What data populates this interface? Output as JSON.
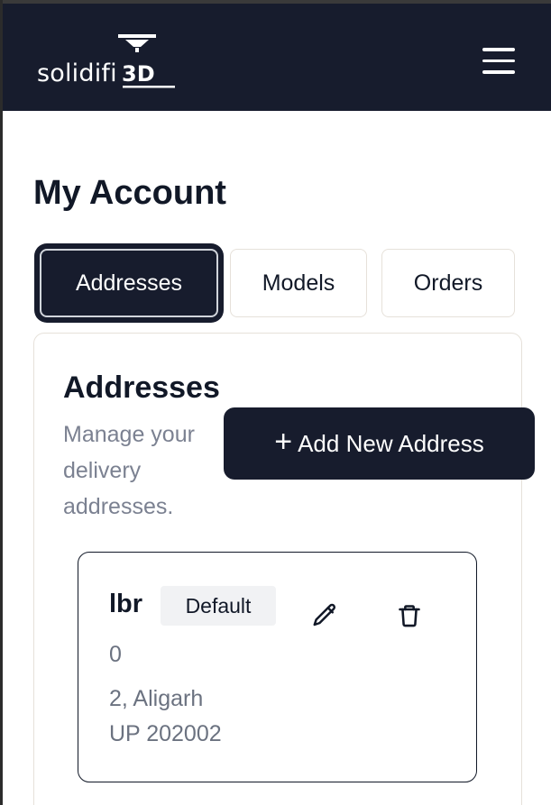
{
  "header": {
    "logo_text": "solidifi",
    "logo_mark": "3D",
    "menu_icon": "hamburger-menu-icon"
  },
  "page": {
    "title": "My Account"
  },
  "tabs": [
    {
      "label": "Addresses",
      "active": true
    },
    {
      "label": "Models",
      "active": false
    },
    {
      "label": "Orders",
      "active": false
    }
  ],
  "addresses_section": {
    "title": "Addresses",
    "description": "Manage your delivery addresses.",
    "add_button_label": "Add New Address",
    "add_button_icon": "plus-icon"
  },
  "address_cards": [
    {
      "name": "lbr",
      "badge": "Default",
      "line1": "0",
      "line2": "2, Aligarh",
      "line3": "UP 202002",
      "edit_icon": "pencil-icon",
      "delete_icon": "trash-icon"
    }
  ],
  "colors": {
    "navy": "#171c2d",
    "border": "#e6e1da",
    "muted_text": "#7b8191",
    "badge_bg": "#f1f2f4"
  }
}
